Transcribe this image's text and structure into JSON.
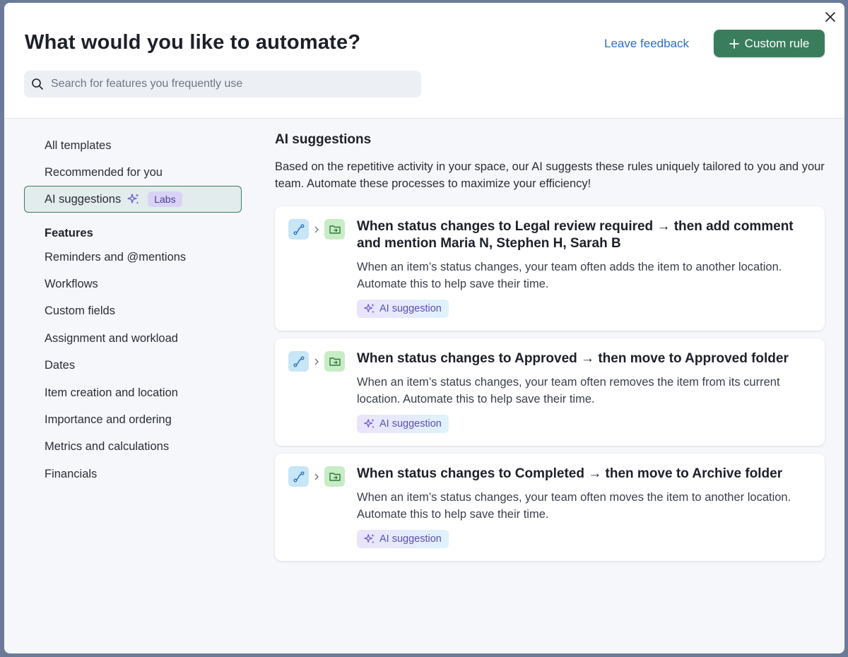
{
  "header": {
    "title": "What would you like to automate?",
    "feedback_label": "Leave feedback",
    "custom_rule_label": "Custom rule",
    "search_placeholder": "Search for features you frequently use"
  },
  "sidebar": {
    "top_items": [
      {
        "label": "All templates"
      },
      {
        "label": "Recommended for you"
      },
      {
        "label": "AI suggestions",
        "badge": "Labs",
        "active": true
      }
    ],
    "features_heading": "Features",
    "features": [
      {
        "label": "Reminders and @mentions"
      },
      {
        "label": "Workflows"
      },
      {
        "label": "Custom fields"
      },
      {
        "label": "Assignment and workload"
      },
      {
        "label": "Dates"
      },
      {
        "label": "Item creation and location"
      },
      {
        "label": "Importance and ordering"
      },
      {
        "label": "Metrics and calculations"
      },
      {
        "label": "Financials"
      }
    ]
  },
  "main": {
    "title": "AI suggestions",
    "description": "Based on the repetitive activity in your space, our AI suggests these rules uniquely tailored to you and your team. Automate these processes to maximize your efficiency!",
    "cards": [
      {
        "title": "When status changes to Legal review required → then add comment and mention Maria N, Stephen H, Sarah B",
        "description": "When an item’s status changes, your team often adds the item to another location. Automate this to help save their time.",
        "chip": "AI suggestion"
      },
      {
        "title": "When status changes to Approved → then move to Approved folder",
        "description": "When an item’s status changes, your team often removes the item from its current location. Automate this to help save their time.",
        "chip": "AI suggestion"
      },
      {
        "title": "When status changes to Completed → then move to Archive folder",
        "description": "When an item’s status changes, your team often moves the item to another location. Automate this to help save their time.",
        "chip": "AI suggestion"
      }
    ]
  },
  "colors": {
    "accent_green": "#3a7d5d",
    "link_blue": "#2d6fc4",
    "ai_purple": "#5d4fb3"
  },
  "icons": [
    "close-icon",
    "plus-icon",
    "search-icon",
    "sparkle-icon",
    "workflow-icon",
    "chevron-right-icon",
    "folder-move-icon"
  ]
}
